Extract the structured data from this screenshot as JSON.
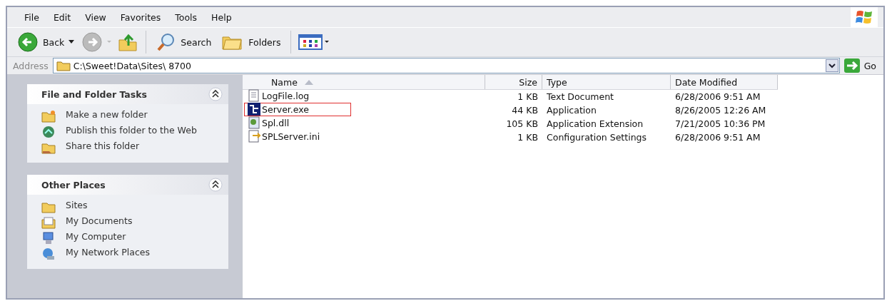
{
  "menu": [
    "File",
    "Edit",
    "View",
    "Favorites",
    "Tools",
    "Help"
  ],
  "toolbar": {
    "back": "Back",
    "search": "Search",
    "folders": "Folders"
  },
  "address": {
    "label": "Address",
    "value": "C:\\Sweet!Data\\Sites\\  8700",
    "go": "Go"
  },
  "panels": [
    {
      "title": "File and Folder Tasks",
      "expanded": true,
      "items": [
        {
          "label": "Make a new folder",
          "kind": "newfolder"
        },
        {
          "label": "Publish this folder to the Web",
          "kind": "publish"
        },
        {
          "label": "Share this folder",
          "kind": "share"
        }
      ]
    },
    {
      "title": "Other Places",
      "expanded": true,
      "items": [
        {
          "label": "Sites",
          "kind": "folder"
        },
        {
          "label": "My Documents",
          "kind": "documents"
        },
        {
          "label": "My Computer",
          "kind": "computer"
        },
        {
          "label": "My Network Places",
          "kind": "network"
        }
      ]
    }
  ],
  "columns": [
    {
      "label": "Name",
      "sorted": true
    },
    {
      "label": "Size",
      "sorted": false
    },
    {
      "label": "Type",
      "sorted": false
    },
    {
      "label": "Date Modified",
      "sorted": false
    }
  ],
  "files": [
    {
      "name": "LogFile.log",
      "size": "1 KB",
      "type": "Text Document",
      "date": "6/28/2006 9:51 AM",
      "kind": "text",
      "highlighted": false
    },
    {
      "name": "Server.exe",
      "size": "44 KB",
      "type": "Application",
      "date": "8/26/2005 12:26 AM",
      "kind": "app",
      "highlighted": true
    },
    {
      "name": "Spl.dll",
      "size": "105 KB",
      "type": "Application Extension",
      "date": "7/21/2005 10:36 PM",
      "kind": "dll",
      "highlighted": false
    },
    {
      "name": "SPLServer.ini",
      "size": "1 KB",
      "type": "Configuration Settings",
      "date": "6/28/2006 9:51 AM",
      "kind": "ini",
      "highlighted": false
    }
  ]
}
